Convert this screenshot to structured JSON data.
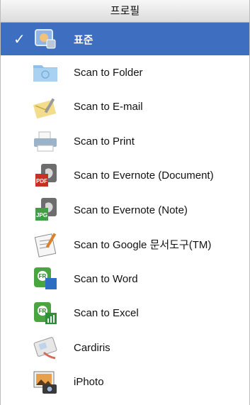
{
  "header": {
    "title": "프로필"
  },
  "selected_mark": "✓",
  "items": [
    {
      "label": "표준",
      "icon": "standard-profile-icon",
      "selected": true
    },
    {
      "label": "Scan to Folder",
      "icon": "folder-icon"
    },
    {
      "label": "Scan to E-mail",
      "icon": "email-icon"
    },
    {
      "label": "Scan to Print",
      "icon": "printer-icon"
    },
    {
      "label": "Scan to Evernote (Document)",
      "icon": "evernote-pdf-icon",
      "badge": "PDF"
    },
    {
      "label": "Scan to Evernote (Note)",
      "icon": "evernote-jpg-icon",
      "badge": "JPG"
    },
    {
      "label": "Scan to Google 문서도구(TM)",
      "icon": "google-docs-icon"
    },
    {
      "label": "Scan to Word",
      "icon": "word-icon"
    },
    {
      "label": "Scan to Excel",
      "icon": "excel-icon"
    },
    {
      "label": "Cardiris",
      "icon": "cardiris-icon"
    },
    {
      "label": "iPhoto",
      "icon": "iphoto-icon"
    }
  ]
}
